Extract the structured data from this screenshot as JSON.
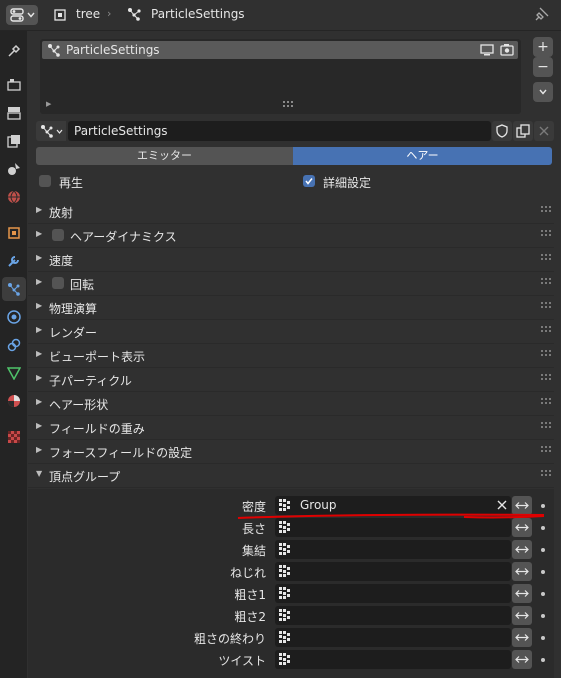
{
  "header": {
    "breadcrumb": [
      "tree",
      "ParticleSettings"
    ]
  },
  "tabs": [
    {
      "name": "tool-icon"
    },
    {
      "name": "render-icon"
    },
    {
      "name": "output-icon"
    },
    {
      "name": "view-layer-icon"
    },
    {
      "name": "scene-icon"
    },
    {
      "name": "world-icon"
    },
    {
      "name": "object-icon"
    },
    {
      "name": "modifier-icon"
    },
    {
      "name": "particles-icon",
      "active": true
    },
    {
      "name": "physics-icon"
    },
    {
      "name": "constraints-icon"
    },
    {
      "name": "data-icon"
    },
    {
      "name": "material-icon"
    },
    {
      "name": "texture-icon"
    }
  ],
  "particle_list": {
    "items": [
      "ParticleSettings"
    ]
  },
  "datablock": {
    "name": "ParticleSettings"
  },
  "type_toggle": {
    "options": [
      "エミッター",
      "ヘアー"
    ],
    "selected": "ヘアー"
  },
  "options": {
    "regrow": {
      "label": "再生",
      "checked": false
    },
    "advanced": {
      "label": "詳細設定",
      "checked": true
    }
  },
  "panels": [
    {
      "label": "放射",
      "expanded": false
    },
    {
      "label": "ヘアーダイナミクス",
      "expanded": false,
      "checkbox": true
    },
    {
      "label": "速度",
      "expanded": false
    },
    {
      "label": "回転",
      "expanded": false,
      "checkbox": true
    },
    {
      "label": "物理演算",
      "expanded": false
    },
    {
      "label": "レンダー",
      "expanded": false
    },
    {
      "label": "ビューポート表示",
      "expanded": false
    },
    {
      "label": "子パーティクル",
      "expanded": false
    },
    {
      "label": "ヘアー形状",
      "expanded": false
    },
    {
      "label": "フィールドの重み",
      "expanded": false
    },
    {
      "label": "フォースフィールドの設定",
      "expanded": false
    },
    {
      "label": "頂点グループ",
      "expanded": true
    }
  ],
  "vertex_groups": [
    {
      "label": "密度",
      "value": "Group"
    },
    {
      "label": "長さ",
      "value": ""
    },
    {
      "label": "集結",
      "value": ""
    },
    {
      "label": "ねじれ",
      "value": ""
    },
    {
      "label": "粗さ1",
      "value": ""
    },
    {
      "label": "粗さ2",
      "value": ""
    },
    {
      "label": "粗さの終わり",
      "value": ""
    },
    {
      "label": "ツイスト",
      "value": ""
    }
  ],
  "colors": {
    "accent": "#4772b3",
    "annotation_underline": "#e00000"
  }
}
